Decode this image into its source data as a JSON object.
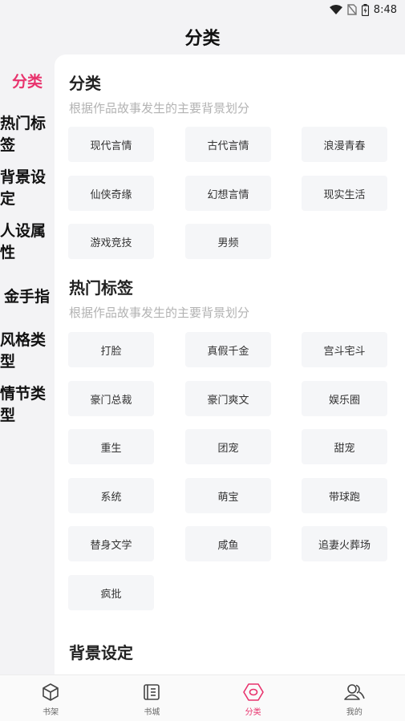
{
  "status": {
    "time": "8:48"
  },
  "header": {
    "title": "分类"
  },
  "left_nav": {
    "items": [
      {
        "label": "分类",
        "active": true
      },
      {
        "label": "热门标签",
        "active": false
      },
      {
        "label": "背景设定",
        "active": false
      },
      {
        "label": "人设属性",
        "active": false
      },
      {
        "label": "金手指",
        "active": false
      },
      {
        "label": "风格类型",
        "active": false
      },
      {
        "label": "情节类型",
        "active": false
      }
    ]
  },
  "sections": [
    {
      "title": "分类",
      "desc": "根据作品故事发生的主要背景划分",
      "tags": [
        "现代言情",
        "古代言情",
        "浪漫青春",
        "仙侠奇缘",
        "幻想言情",
        "现实生活",
        "游戏竞技",
        "男频"
      ]
    },
    {
      "title": "热门标签",
      "desc": "根据作品故事发生的主要背景划分",
      "tags": [
        "打脸",
        "真假千金",
        "宫斗宅斗",
        "豪门总裁",
        "豪门爽文",
        "娱乐圈",
        "重生",
        "团宠",
        "甜宠",
        "系统",
        "萌宝",
        "带球跑",
        "替身文学",
        "咸鱼",
        "追妻火葬场",
        "疯批"
      ]
    },
    {
      "title": "背景设定"
    }
  ],
  "tab_bar": {
    "tabs": [
      {
        "label": "书架",
        "icon": "cube-icon"
      },
      {
        "label": "书城",
        "icon": "book-icon"
      },
      {
        "label": "分类",
        "icon": "hexagon-icon",
        "active": true
      },
      {
        "label": "我的",
        "icon": "user-icon"
      }
    ]
  },
  "colors": {
    "accent": "#e8336d",
    "tag_bg": "#f5f6f8",
    "desc": "#b3b3b3"
  }
}
